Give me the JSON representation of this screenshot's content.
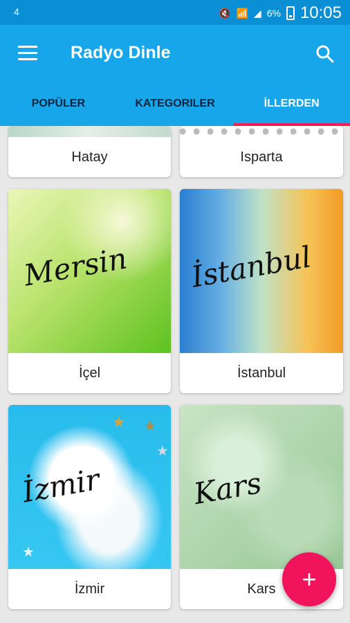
{
  "status": {
    "left_icon": "4",
    "battery_text": "6%",
    "time": "10:05"
  },
  "appbar": {
    "title": "Radyo Dinle"
  },
  "tabs": [
    {
      "label": "POPÜLER",
      "active": false
    },
    {
      "label": "KATEGORILER",
      "active": false
    },
    {
      "label": "İLLERDEN",
      "active": true
    }
  ],
  "cards": {
    "hatay": {
      "label": "Hatay"
    },
    "isparta": {
      "label": "Isparta"
    },
    "icel": {
      "label": "İçel",
      "image_text": "Mersin"
    },
    "istanbul": {
      "label": "İstanbul",
      "image_text": "İstanbul"
    },
    "izmir": {
      "label": "İzmir",
      "image_text": "İzmir"
    },
    "kars": {
      "label": "Kars",
      "image_text": "Kars"
    }
  },
  "fab": {
    "label": "+"
  },
  "colors": {
    "statusbar": "#0a8fd4",
    "appbar": "#17a6ea",
    "tab_indicator": "#f11f5b",
    "fab": "#f1135c"
  }
}
